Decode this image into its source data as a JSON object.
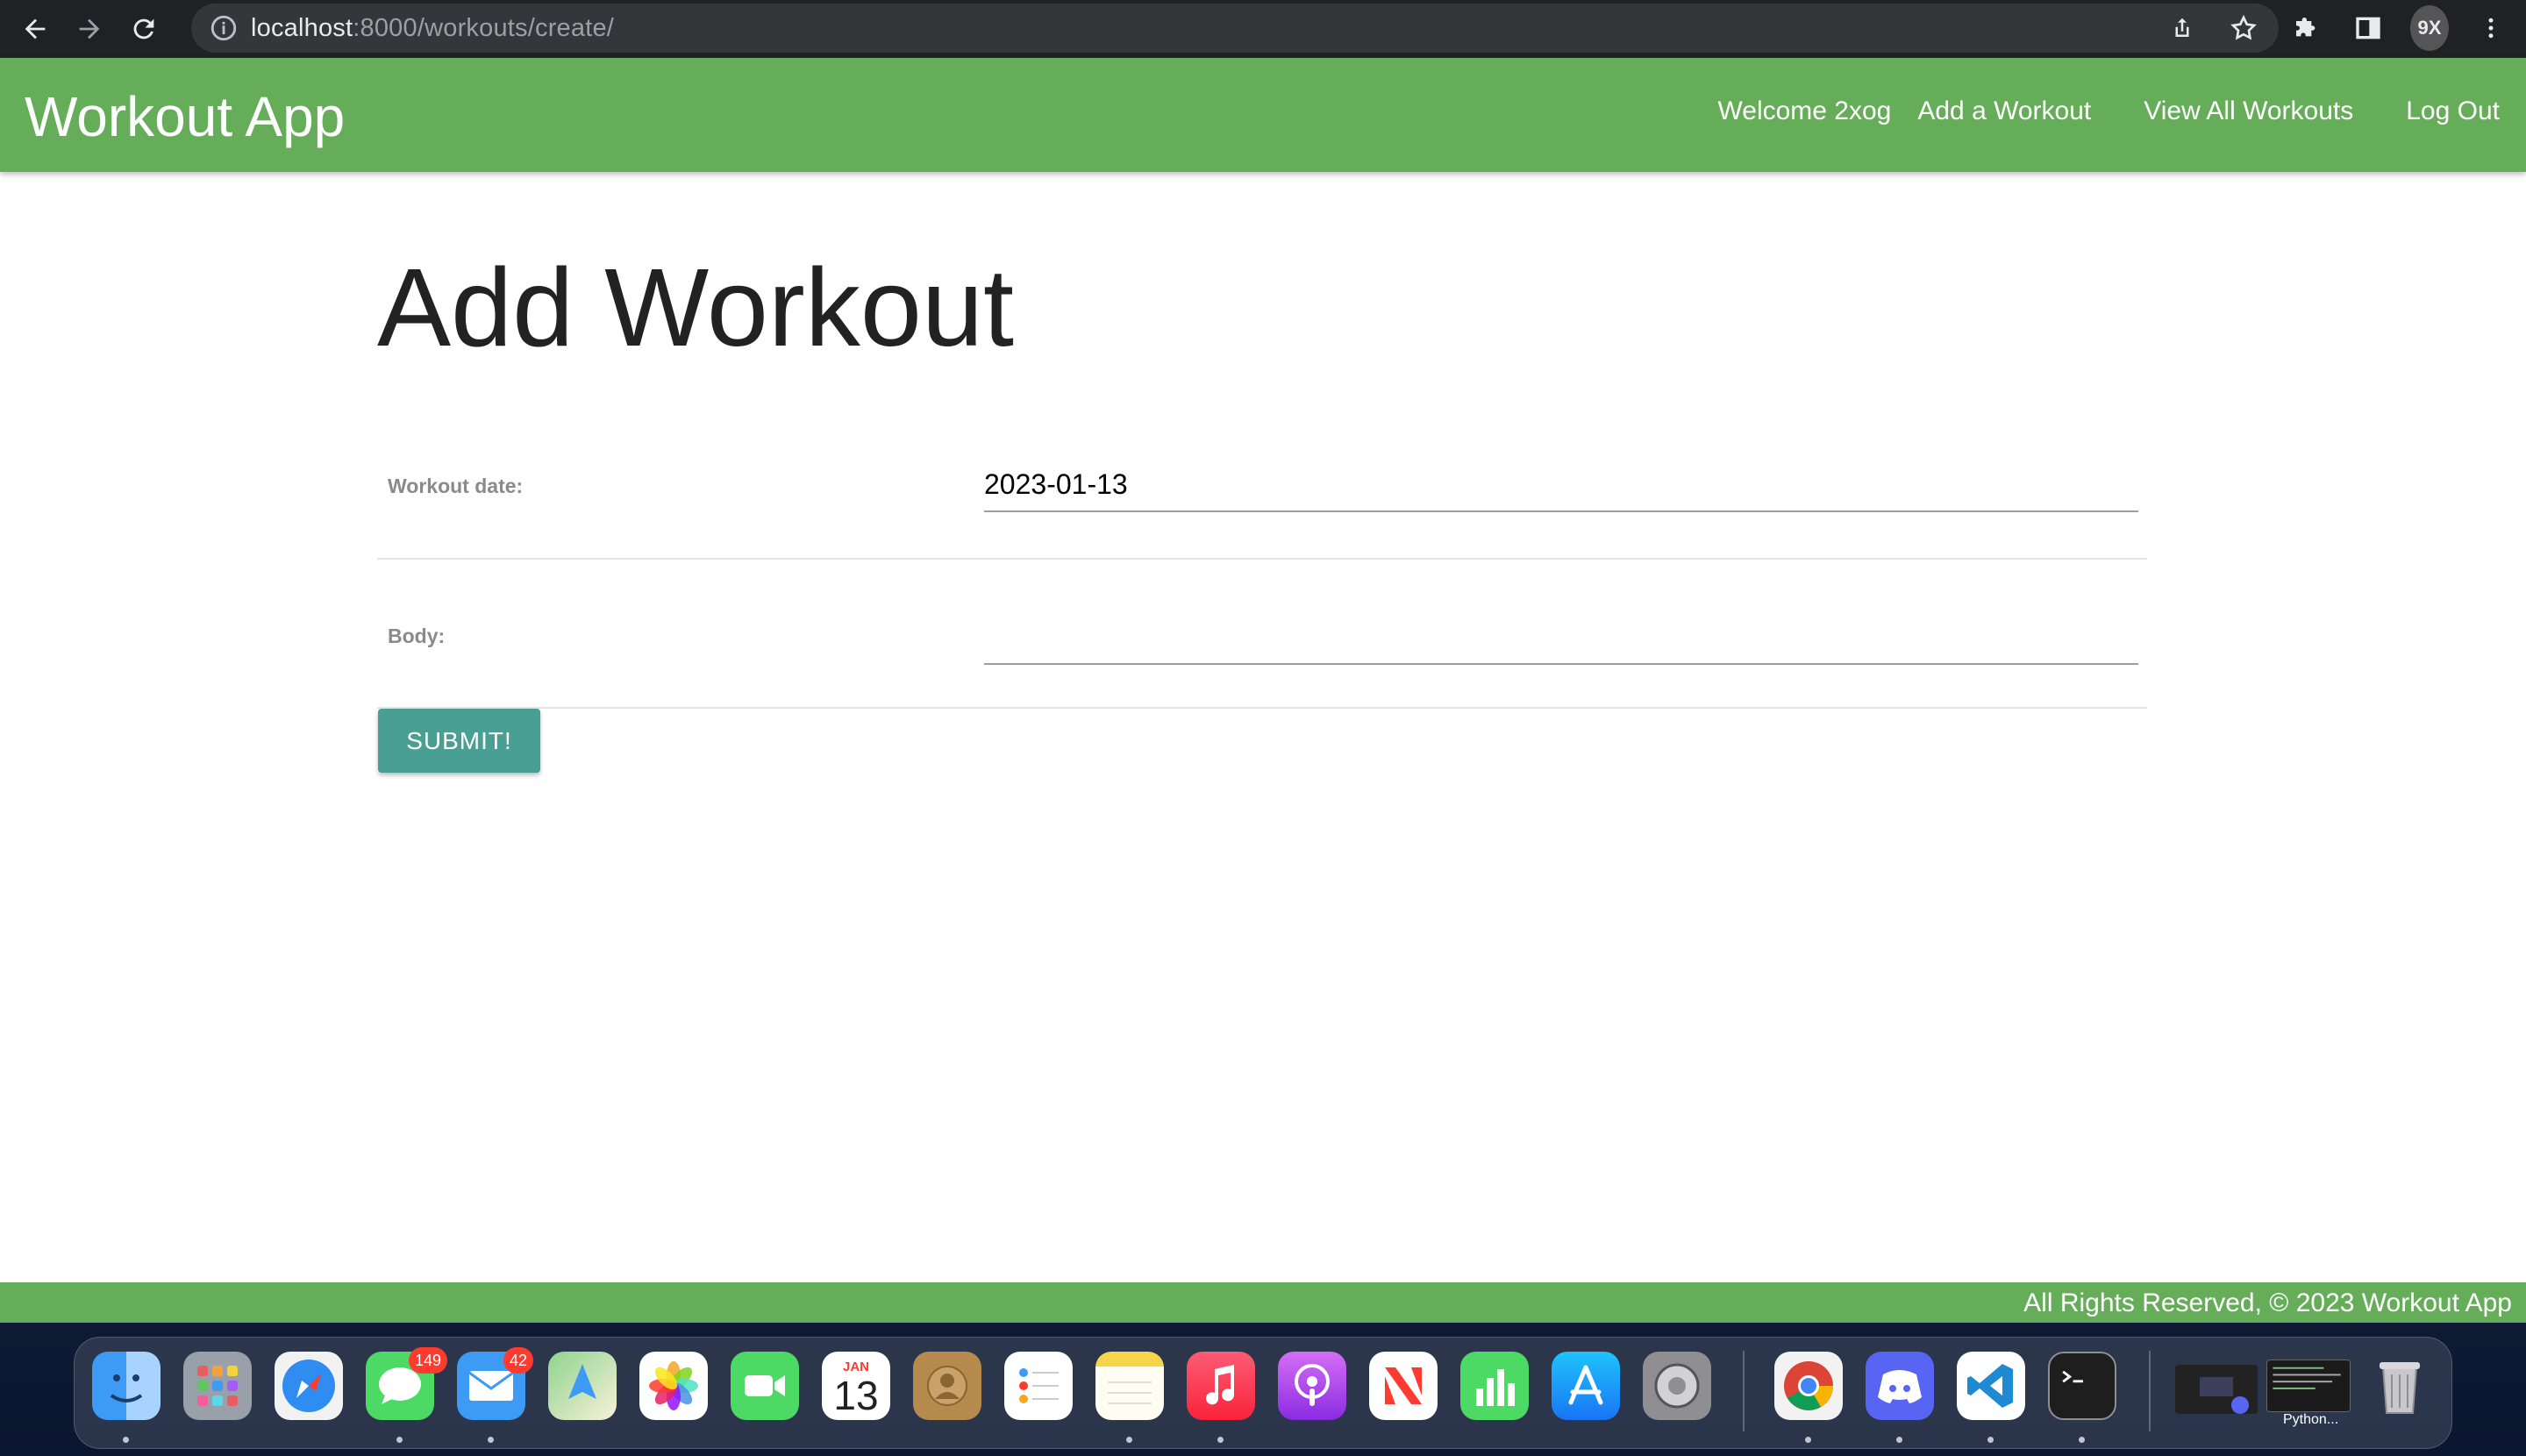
{
  "browser": {
    "url_host": "localhost",
    "url_path": ":8000/workouts/create/",
    "profile_initials": "9X"
  },
  "navbar": {
    "brand": "Workout App",
    "welcome": "Welcome 2xog",
    "add_workout": "Add a Workout",
    "view_all": "View All Workouts",
    "log_out": "Log Out",
    "color": "#66ad5a"
  },
  "form": {
    "title": "Add Workout",
    "date_label": "Workout date:",
    "date_value": "2023-01-13",
    "body_label": "Body:",
    "body_value": "",
    "submit_label": "SUBMIT!",
    "submit_color": "#4a9f94"
  },
  "footer": {
    "text": "All Rights Reserved, © 2023 Workout App"
  },
  "dock": {
    "messages_badge": "149",
    "mail_badge": "42",
    "calendar_month": "JAN",
    "calendar_day": "13",
    "python_label": "Python...",
    "apps": [
      "finder-icon",
      "launchpad-icon",
      "safari-icon",
      "messages-icon",
      "mail-icon",
      "maps-icon",
      "photos-icon",
      "facetime-icon",
      "calendar-icon",
      "contacts-icon",
      "reminders-icon",
      "notes-icon",
      "music-icon",
      "podcasts-icon",
      "news-icon",
      "numbers-icon",
      "app-store-icon",
      "system-settings-icon",
      "chrome-icon",
      "discord-icon",
      "vscode-icon",
      "terminal-icon",
      "trash-icon"
    ]
  }
}
